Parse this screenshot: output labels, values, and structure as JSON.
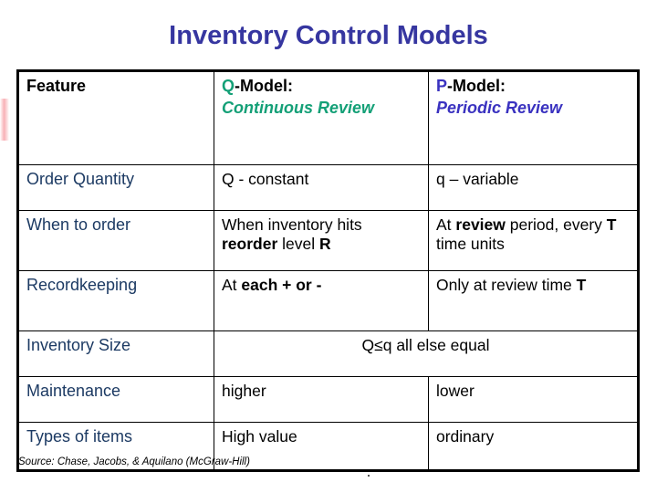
{
  "slide": {
    "title": "Inventory Control Models",
    "title_color": "#3636a0",
    "source_note": "Source: Chase, Jacobs, & Aquilano (McGraw-Hill)"
  },
  "colors": {
    "q_accent": "#14a077",
    "p_accent": "#3a32c0",
    "feature_label": "#1c3a63",
    "border": "#000000",
    "edge_mark": "#f7a3a8"
  },
  "table": {
    "header": {
      "feature": "Feature",
      "q_letter": "Q",
      "q_rest": "-Model:",
      "q_subtitle": "Continuous Review",
      "p_letter": "P",
      "p_rest": "-Model:",
      "p_subtitle": "Periodic Review"
    },
    "rows": [
      {
        "feature": "Order Quantity",
        "q_parts": [
          {
            "text": "Q - constant",
            "bold": false
          }
        ],
        "p_parts": [
          {
            "text": "q – variable",
            "bold": false
          }
        ],
        "merged": false
      },
      {
        "feature": "When to order",
        "q_parts": [
          {
            "text": "When inventory hits ",
            "bold": false
          },
          {
            "text": "reorder",
            "bold": true
          },
          {
            "text": " level ",
            "bold": false
          },
          {
            "text": "R",
            "bold": true
          }
        ],
        "p_parts": [
          {
            "text": "At ",
            "bold": false
          },
          {
            "text": "review",
            "bold": true
          },
          {
            "text": " period, every ",
            "bold": false
          },
          {
            "text": "T",
            "bold": true
          },
          {
            "text": " time units",
            "bold": false
          }
        ],
        "merged": false
      },
      {
        "feature": "Recordkeeping",
        "q_parts": [
          {
            "text": "At ",
            "bold": false
          },
          {
            "text": "each + or -",
            "bold": true
          }
        ],
        "p_parts": [
          {
            "text": "Only at review time ",
            "bold": false
          },
          {
            "text": "T",
            "bold": true
          }
        ],
        "merged": false
      },
      {
        "feature": "Inventory Size",
        "merged": true,
        "merged_text": "Q≤q all else equal"
      },
      {
        "feature": "Maintenance",
        "q_parts": [
          {
            "text": "higher",
            "bold": false
          }
        ],
        "p_parts": [
          {
            "text": "lower",
            "bold": false
          }
        ],
        "merged": false
      },
      {
        "feature": "Types of items",
        "q_parts": [
          {
            "text": "High value",
            "bold": false
          }
        ],
        "p_parts": [
          {
            "text": "ordinary",
            "bold": false
          }
        ],
        "merged": false
      }
    ]
  }
}
